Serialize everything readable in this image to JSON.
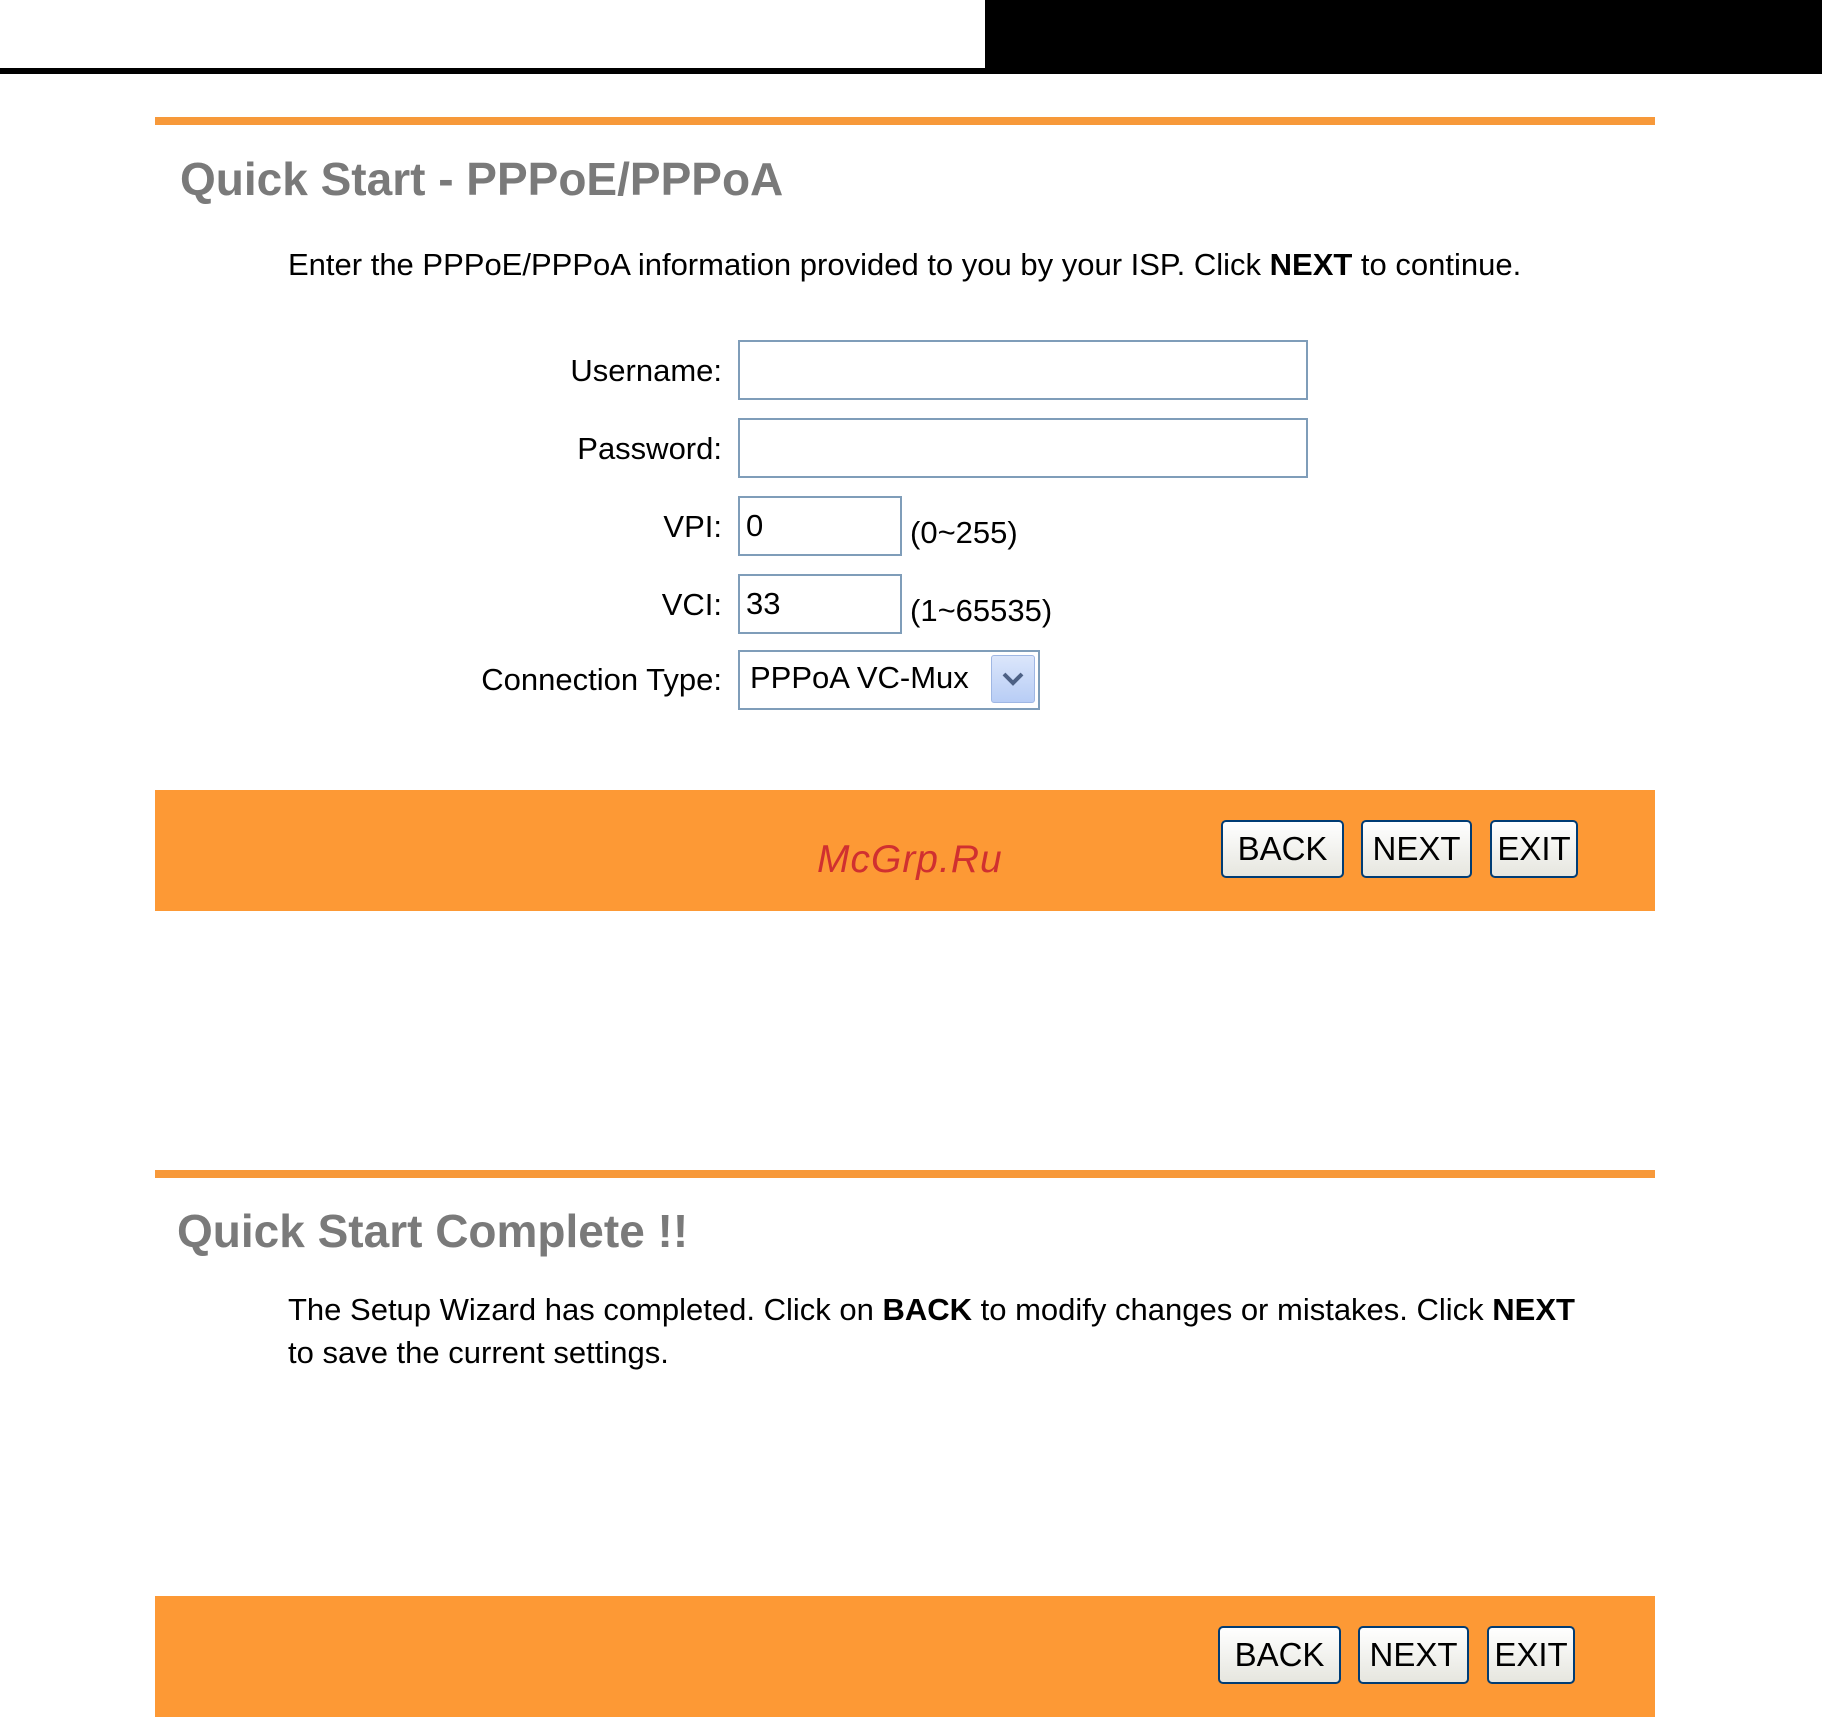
{
  "section1": {
    "title": "Quick Start - PPPoE/PPPoA",
    "instruction_pre": "Enter the PPPoE/PPPoA information provided to you by your ISP. Click ",
    "instruction_bold": "NEXT",
    "instruction_post": " to continue.",
    "fields": {
      "username_label": "Username:",
      "username_value": "",
      "password_label": "Password:",
      "password_value": "",
      "vpi_label": "VPI:",
      "vpi_value": "0",
      "vpi_range": "(0~255)",
      "vci_label": "VCI:",
      "vci_value": "33",
      "vci_range": "(1~65535)",
      "connection_type_label": "Connection Type:",
      "connection_type_value": "PPPoA VC-Mux"
    },
    "buttons": {
      "back": "BACK",
      "next": "NEXT",
      "exit": "EXIT"
    }
  },
  "watermark": "McGrp.Ru",
  "section2": {
    "title": "Quick Start Complete !!",
    "line1_a": "The Setup Wizard has completed. Click on ",
    "line1_b": "BACK",
    "line1_c": " to modify changes or mistakes. Click ",
    "line1_d": "NEXT",
    "line2": "to save the current settings.",
    "buttons": {
      "back": "BACK",
      "next": "NEXT",
      "exit": "EXIT"
    }
  },
  "colors": {
    "accent_orange": "#fd9935",
    "title_gray": "#7a7a7a",
    "field_border": "#7f9db9",
    "watermark_red": "#d03030"
  },
  "icons": {
    "select_arrow": "chevron-down-icon"
  }
}
